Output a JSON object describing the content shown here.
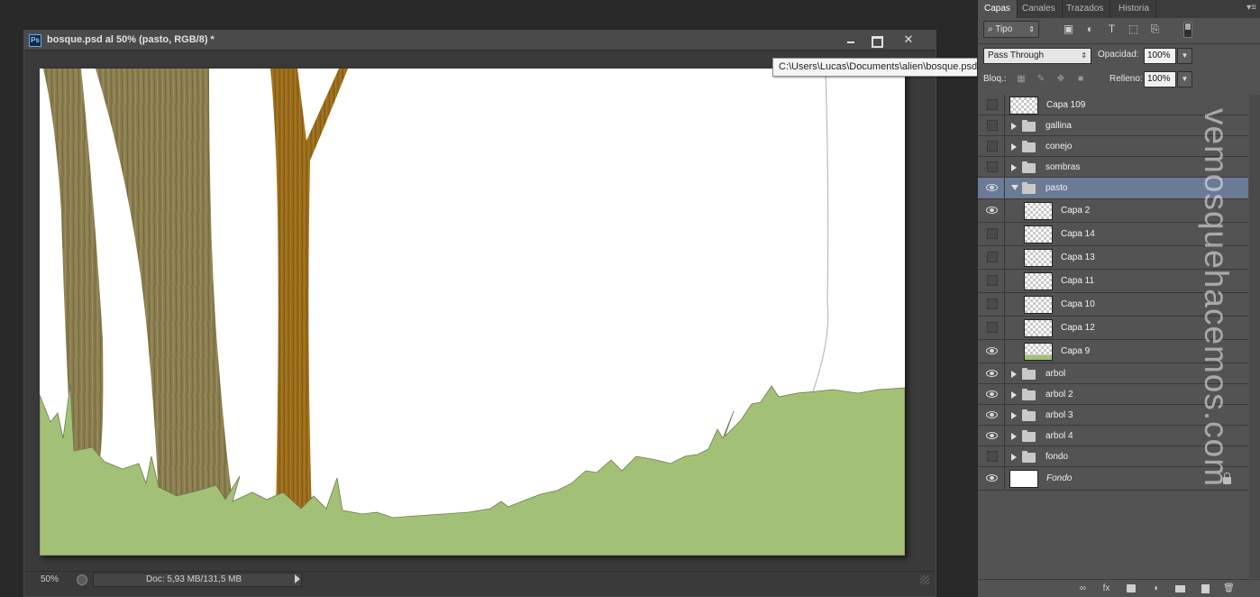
{
  "document": {
    "title": "bosque.psd al 50% (pasto, RGB/8) *",
    "app_icon": "Ps",
    "zoom": "50%",
    "doc_info": "Doc: 5,93 MB/131,5 MB"
  },
  "tooltip": "C:\\Users\\Lucas\\Documents\\alien\\bosque.psd al 50% (arbol 4, RGB/8) *",
  "panel": {
    "tabs": [
      "Capas",
      "Canales",
      "Trazados",
      "Historia"
    ],
    "active_tab": "Capas",
    "filter_label": "Tipo",
    "blend_mode": "Pass Through",
    "opacity_label": "Opacidad:",
    "opacity_value": "100%",
    "lock_label": "Bloq.:",
    "fill_label": "Relleno:",
    "fill_value": "100%"
  },
  "layers": [
    {
      "name": "Capa 109",
      "kind": "layer",
      "visible": false,
      "indent": 0,
      "thumb": "transparent"
    },
    {
      "name": "gallina",
      "kind": "group",
      "visible": false,
      "indent": 0,
      "open": false
    },
    {
      "name": "conejo",
      "kind": "group",
      "visible": false,
      "indent": 0,
      "open": false
    },
    {
      "name": "sombras",
      "kind": "group",
      "visible": false,
      "indent": 0,
      "open": false
    },
    {
      "name": "pasto",
      "kind": "group",
      "visible": true,
      "indent": 0,
      "open": true,
      "selected": true
    },
    {
      "name": "Capa 2",
      "kind": "layer",
      "visible": true,
      "indent": 1,
      "thumb": "transparent"
    },
    {
      "name": "Capa 14",
      "kind": "layer",
      "visible": false,
      "indent": 1,
      "thumb": "transparent"
    },
    {
      "name": "Capa 13",
      "kind": "layer",
      "visible": false,
      "indent": 1,
      "thumb": "transparent"
    },
    {
      "name": "Capa 11",
      "kind": "layer",
      "visible": false,
      "indent": 1,
      "thumb": "transparent"
    },
    {
      "name": "Capa 10",
      "kind": "layer",
      "visible": false,
      "indent": 1,
      "thumb": "transparent"
    },
    {
      "name": "Capa 12",
      "kind": "layer",
      "visible": false,
      "indent": 1,
      "thumb": "transparent"
    },
    {
      "name": "Capa 9",
      "kind": "layer",
      "visible": true,
      "indent": 1,
      "thumb": "grass"
    },
    {
      "name": "arbol",
      "kind": "group",
      "visible": true,
      "indent": 0,
      "open": false
    },
    {
      "name": "arbol 2",
      "kind": "group",
      "visible": true,
      "indent": 0,
      "open": false
    },
    {
      "name": "arbol 3",
      "kind": "group",
      "visible": true,
      "indent": 0,
      "open": false
    },
    {
      "name": "arbol 4",
      "kind": "group",
      "visible": true,
      "indent": 0,
      "open": false
    },
    {
      "name": "fondo",
      "kind": "group",
      "visible": false,
      "indent": 0,
      "open": false
    },
    {
      "name": "Fondo",
      "kind": "background",
      "visible": true,
      "indent": 0,
      "thumb": "white",
      "locked": true,
      "italic": true
    }
  ],
  "watermark": "vemosquehacemos.com",
  "colors": {
    "grass": "#a3c176",
    "trunk_light": "#8a7d4e",
    "trunk_orange": "#9a6c1c",
    "selected_row": "#6b7b95"
  }
}
